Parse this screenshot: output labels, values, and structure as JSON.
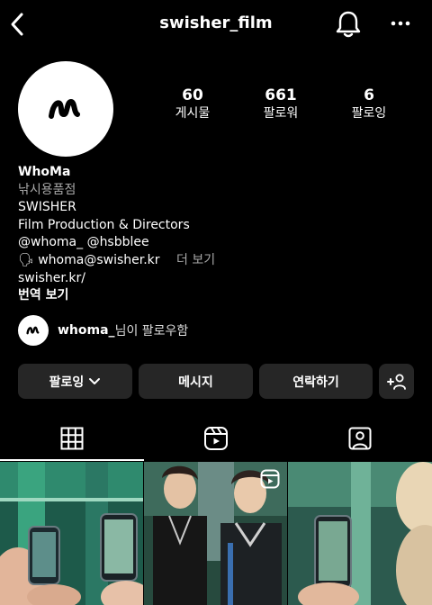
{
  "header": {
    "username": "swisher_film",
    "icons": [
      "back-icon",
      "bell-icon",
      "more-icon"
    ]
  },
  "stats": [
    {
      "count": "60",
      "label": "게시물"
    },
    {
      "count": "661",
      "label": "팔로워"
    },
    {
      "count": "6",
      "label": "팔로잉"
    }
  ],
  "bio": {
    "name": "WhoMa",
    "category": "낚시용품점",
    "line1": "SWISHER",
    "line2": "Film Production & Directors",
    "mention1": "@whoma_",
    "mention2": "@hsbblee",
    "email_emoji": "🗣",
    "email": "whoma@swisher.kr",
    "more": "더 보기",
    "link": "swisher.kr/",
    "translate": "번역 보기"
  },
  "followed_by": {
    "name": "whoma_",
    "suffix": "님이 팔로우함"
  },
  "buttons": {
    "following": "팔로잉",
    "message": "메시지",
    "contact": "연락하기"
  },
  "tabs": [
    "grid-icon",
    "reels-icon",
    "tagged-icon"
  ],
  "colors": {
    "background": "#000000",
    "button": "#262626",
    "secondary_text": "#a8a8a8"
  }
}
